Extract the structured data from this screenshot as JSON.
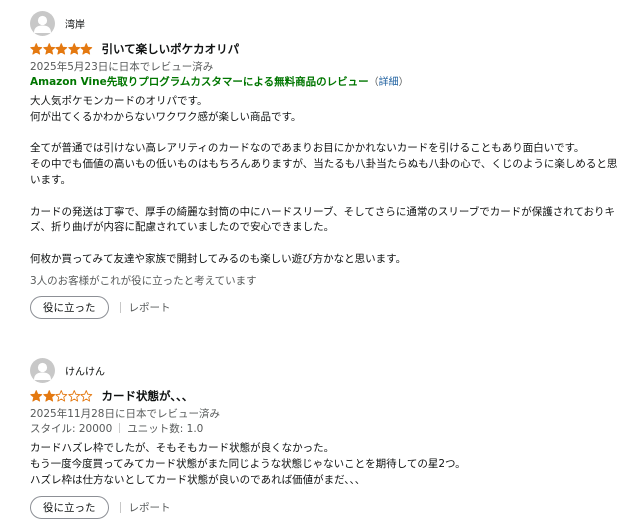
{
  "colors": {
    "star_fill": "#e47911",
    "star_empty": "#e47911",
    "vine_green": "#007600",
    "link": "#2162a1"
  },
  "reviews": [
    {
      "profile_name": "湾岸",
      "rating": 5,
      "title": "引いて楽しいポケカオリパ",
      "date": "2025年5月23日に日本でレビュー済み",
      "vine_label": "Amazon Vine先取りプログラムカスタマーによる無料商品のレビュー",
      "vine_open": "（",
      "vine_link": "詳細",
      "vine_close": "）",
      "body": [
        "大人気ポケモンカードのオリパです。",
        "何が出てくるかわからないワクワク感が楽しい商品です。",
        "",
        "全てが普通では引けない高レアリティのカードなのであまりお目にかかれないカードを引けることもあり面白いです。",
        "その中でも価値の高いもの低いものはもちろんありますが、当たるも八卦当たらぬも八卦の心で、くじのように楽しめると思います。",
        "",
        "カードの発送は丁寧で、厚手の綺麗な封筒の中にハードスリーブ、そしてさらに通常のスリーブでカードが保護されておりキズ、折り曲げが内容に配慮されていましたので安心できました。",
        "",
        "何枚か買ってみて友達や家族で開封してみるのも楽しい遊び方かなと思います。"
      ],
      "helpful_text": "3人のお客様がこれが役に立ったと考えています",
      "helpful_button": "役に立った",
      "report_label": "レポート"
    },
    {
      "profile_name": "けんけん",
      "rating": 2,
      "title": "カード状態が、、、",
      "date": "2025年11月28日に日本でレビュー済み",
      "style_label": "スタイル: 20000",
      "unit_label": "ユニット数: 1.0",
      "body": [
        "カードハズレ枠でしたが、そもそもカード状態が良くなかった。",
        "もう一度今度買ってみてカード状態がまた同じような状態じゃないことを期待しての星2つ。",
        "ハズレ枠は仕方ないとしてカード状態が良いのであれば価値がまだ、、、"
      ],
      "helpful_button": "役に立った",
      "report_label": "レポート"
    }
  ]
}
